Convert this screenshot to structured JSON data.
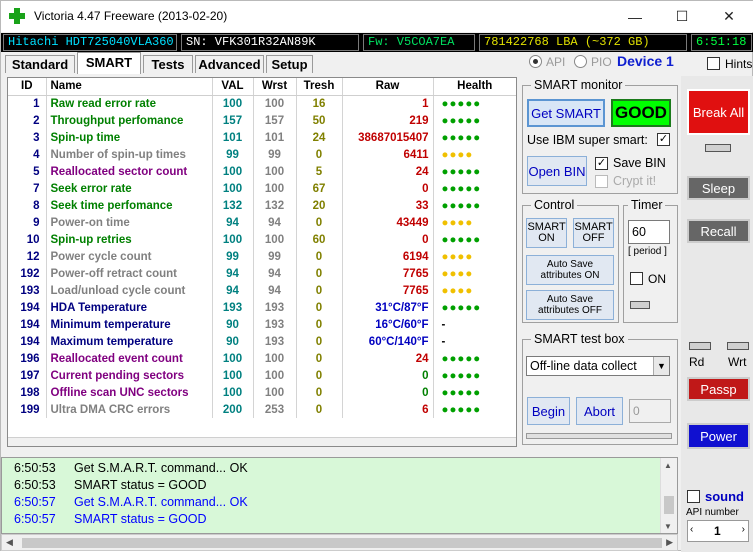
{
  "window": {
    "title": "Victoria 4.47  Freeware (2013-02-20)",
    "minimize_glyph": "—",
    "maximize_glyph": "☐",
    "close_glyph": "✕"
  },
  "info": {
    "model": "Hitachi HDT725040VLA360",
    "serial": "SN: VFK301R32AN89K",
    "firmware": "Fw: V5COA7EA",
    "lba": "781422768 LBA (~372 GB)",
    "clock": "6:51:18"
  },
  "tabs": [
    "Standard",
    "SMART",
    "Tests",
    "Advanced",
    "Setup"
  ],
  "mode": {
    "api_label": "API",
    "pio_label": "PIO",
    "device_label": "Device 1",
    "hints_label": "Hints"
  },
  "smart_table": {
    "headers": [
      "ID",
      "Name",
      "VAL",
      "Wrst",
      "Tresh",
      "Raw",
      "Health"
    ],
    "rows": [
      {
        "id": "1",
        "name": "Raw read error rate",
        "val": "100",
        "wrst": "100",
        "tresh": "16",
        "raw": "1",
        "health": "●●●●●",
        "name_color": "green",
        "health_color": "green",
        "raw_color": "red"
      },
      {
        "id": "2",
        "name": "Throughput perfomance",
        "val": "157",
        "wrst": "157",
        "tresh": "50",
        "raw": "219",
        "health": "●●●●●",
        "name_color": "green",
        "health_color": "green",
        "raw_color": "red"
      },
      {
        "id": "3",
        "name": "Spin-up time",
        "val": "101",
        "wrst": "101",
        "tresh": "24",
        "raw": "38687015407",
        "health": "●●●●●",
        "name_color": "green",
        "health_color": "green",
        "raw_color": "red"
      },
      {
        "id": "4",
        "name": "Number of spin-up times",
        "val": "99",
        "wrst": "99",
        "tresh": "0",
        "raw": "6411",
        "health": "●●●●",
        "name_color": "gray",
        "health_color": "yellow",
        "raw_color": "red"
      },
      {
        "id": "5",
        "name": "Reallocated sector count",
        "val": "100",
        "wrst": "100",
        "tresh": "5",
        "raw": "24",
        "health": "●●●●●",
        "name_color": "purple",
        "health_color": "green",
        "raw_color": "red"
      },
      {
        "id": "7",
        "name": "Seek error rate",
        "val": "100",
        "wrst": "100",
        "tresh": "67",
        "raw": "0",
        "health": "●●●●●",
        "name_color": "green",
        "health_color": "green",
        "raw_color": "red"
      },
      {
        "id": "8",
        "name": "Seek time perfomance",
        "val": "132",
        "wrst": "132",
        "tresh": "20",
        "raw": "33",
        "health": "●●●●●",
        "name_color": "green",
        "health_color": "green",
        "raw_color": "red"
      },
      {
        "id": "9",
        "name": "Power-on time",
        "val": "94",
        "wrst": "94",
        "tresh": "0",
        "raw": "43449",
        "health": "●●●●",
        "name_color": "gray",
        "health_color": "yellow",
        "raw_color": "red"
      },
      {
        "id": "10",
        "name": "Spin-up retries",
        "val": "100",
        "wrst": "100",
        "tresh": "60",
        "raw": "0",
        "health": "●●●●●",
        "name_color": "green",
        "health_color": "green",
        "raw_color": "red"
      },
      {
        "id": "12",
        "name": "Power cycle count",
        "val": "99",
        "wrst": "99",
        "tresh": "0",
        "raw": "6194",
        "health": "●●●●",
        "name_color": "gray",
        "health_color": "yellow",
        "raw_color": "red"
      },
      {
        "id": "192",
        "name": "Power-off retract count",
        "val": "94",
        "wrst": "94",
        "tresh": "0",
        "raw": "7765",
        "health": "●●●●",
        "name_color": "gray",
        "health_color": "yellow",
        "raw_color": "red"
      },
      {
        "id": "193",
        "name": "Load/unload cycle count",
        "val": "94",
        "wrst": "94",
        "tresh": "0",
        "raw": "7765",
        "health": "●●●●",
        "name_color": "gray",
        "health_color": "yellow",
        "raw_color": "red"
      },
      {
        "id": "194",
        "name": "HDA Temperature",
        "val": "193",
        "wrst": "193",
        "tresh": "0",
        "raw": "31°C/87°F",
        "health": "●●●●●",
        "name_color": "navy",
        "health_color": "green",
        "raw_color": "blue"
      },
      {
        "id": "194",
        "name": "Minimum temperature",
        "val": "90",
        "wrst": "193",
        "tresh": "0",
        "raw": "16°C/60°F",
        "health": "-",
        "name_color": "navy",
        "health_color": "none",
        "raw_color": "blue"
      },
      {
        "id": "194",
        "name": "Maximum temperature",
        "val": "90",
        "wrst": "193",
        "tresh": "0",
        "raw": "60°C/140°F",
        "health": "-",
        "name_color": "navy",
        "health_color": "none",
        "raw_color": "blue"
      },
      {
        "id": "196",
        "name": "Reallocated event count",
        "val": "100",
        "wrst": "100",
        "tresh": "0",
        "raw": "24",
        "health": "●●●●●",
        "name_color": "purple",
        "health_color": "green",
        "raw_color": "red"
      },
      {
        "id": "197",
        "name": "Current pending sectors",
        "val": "100",
        "wrst": "100",
        "tresh": "0",
        "raw": "0",
        "health": "●●●●●",
        "name_color": "purple",
        "health_color": "green",
        "raw_color": "green"
      },
      {
        "id": "198",
        "name": "Offline scan UNC sectors",
        "val": "100",
        "wrst": "100",
        "tresh": "0",
        "raw": "0",
        "health": "●●●●●",
        "name_color": "purple",
        "health_color": "green",
        "raw_color": "green"
      },
      {
        "id": "199",
        "name": "Ultra DMA CRC errors",
        "val": "200",
        "wrst": "253",
        "tresh": "0",
        "raw": "6",
        "health": "●●●●●",
        "name_color": "gray",
        "health_color": "green",
        "raw_color": "red"
      }
    ]
  },
  "smart_monitor": {
    "title": "SMART monitor",
    "get_smart": "Get SMART",
    "status": "GOOD",
    "ibm_label": "Use IBM super smart:",
    "open_bin": "Open BIN",
    "save_bin": "Save BIN",
    "crypt": "Crypt it!"
  },
  "control": {
    "title": "Control",
    "smart_on": "SMART ON",
    "smart_off": "SMART OFF",
    "autosave_on": "Auto Save attributes ON",
    "autosave_off": "Auto Save attributes OFF"
  },
  "timer": {
    "title": "Timer",
    "value": "60",
    "period": "[ period ]",
    "on_label": "ON"
  },
  "test_box": {
    "title": "SMART test box",
    "selected": "Off-line data collect",
    "begin": "Begin",
    "abort": "Abort",
    "field": "0"
  },
  "right_panel": {
    "break_all": "Break All",
    "sleep": "Sleep",
    "recall": "Recall",
    "rd": "Rd",
    "wrt": "Wrt",
    "passp": "Passp",
    "power": "Power",
    "sound": "sound",
    "api_number_label": "API number",
    "api_number": "1"
  },
  "log": [
    {
      "time": "6:50:53",
      "msg": "Get S.M.A.R.T. command... OK",
      "color": "#000000"
    },
    {
      "time": "6:50:53",
      "msg": "SMART status = GOOD",
      "color": "#000000"
    },
    {
      "time": "6:50:57",
      "msg": "Get S.M.A.R.T. command... OK",
      "color": "#0000ff"
    },
    {
      "time": "6:50:57",
      "msg": "SMART status = GOOD",
      "color": "#0000ff"
    }
  ],
  "colors": {
    "good": "#00ff00",
    "break": "#e01010",
    "passp": "#c01818",
    "power": "#1010d0",
    "info_bg": "#000000",
    "log_bg": "#d8f8d8"
  }
}
